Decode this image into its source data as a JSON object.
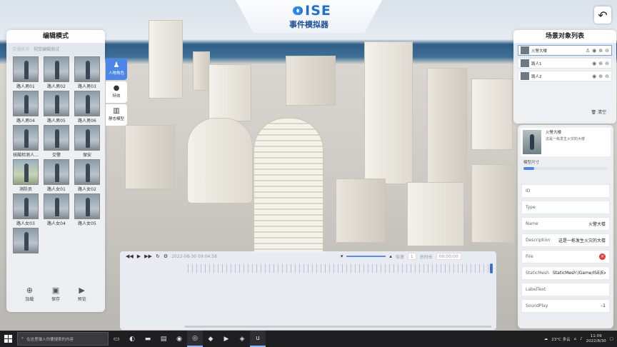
{
  "header": {
    "logo_text": "ISE",
    "subtitle": "事件模拟器"
  },
  "left_panel": {
    "title": "编辑模式",
    "sub_tabs": [
      "交通状况",
      "视觉编辑测试"
    ],
    "characters": [
      {
        "label": "路人男01"
      },
      {
        "label": "路人男02"
      },
      {
        "label": "路人男03"
      },
      {
        "label": "路人男04"
      },
      {
        "label": "路人男05"
      },
      {
        "label": "路人男06"
      },
      {
        "label": "核酸检测人..."
      },
      {
        "label": "交警"
      },
      {
        "label": "保安"
      },
      {
        "label": "消防员"
      },
      {
        "label": "路人女01"
      },
      {
        "label": "路人女02"
      },
      {
        "label": "路人女03"
      },
      {
        "label": "路人女04"
      },
      {
        "label": "路人女05"
      },
      {
        "label": ""
      }
    ],
    "actions": [
      "加载",
      "保存",
      "预览"
    ]
  },
  "side_tabs": [
    {
      "label": "人物角色",
      "icon": "person-icon",
      "active": true
    },
    {
      "label": "特效",
      "icon": "effect-icon",
      "active": false
    },
    {
      "label": "静态模型",
      "icon": "building-icon",
      "active": false
    }
  ],
  "timeline": {
    "timestamp": "2022-08-30 09:04:58",
    "speed_label": "倍速",
    "speed_value": "1",
    "frame_label": "总时长",
    "frame_value": "00:00:00"
  },
  "right_panel": {
    "title": "场景对象列表",
    "objects": [
      {
        "name": "火警大楼"
      },
      {
        "name": "路人1"
      },
      {
        "name": "路人2"
      }
    ],
    "clear_label": "清空"
  },
  "detail": {
    "name": "火警大楼",
    "desc": "这是一栋发生火灾的大楼",
    "scale_label": "模型尺寸",
    "scale_fraction": 0.13,
    "props": [
      {
        "key": "ID",
        "value": ""
      },
      {
        "key": "Type",
        "value": ""
      },
      {
        "key": "Name",
        "value": "火警大楼"
      },
      {
        "key": "Description",
        "value": "这是一栋发生火灾的大楼"
      },
      {
        "key": "Fire",
        "value": ""
      },
      {
        "key": "StaticMesh",
        "value": "StaticMesh'/Game/ISE/Exa"
      },
      {
        "key": "LabelText",
        "value": ""
      },
      {
        "key": "SoundPlay",
        "value": "-1"
      }
    ]
  },
  "taskbar": {
    "search_placeholder": "在这里输入你要搜索的内容",
    "weather": "23°C 多云",
    "time": "11:09",
    "date": "2022/8/30"
  }
}
